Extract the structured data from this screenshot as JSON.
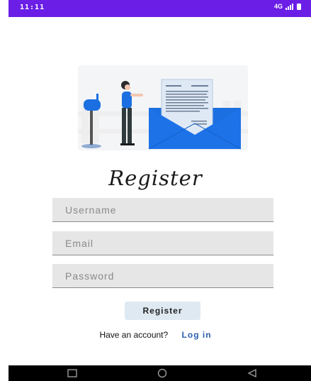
{
  "status_bar": {
    "time": "11:11",
    "network": "4G",
    "color": "#6a1ee6"
  },
  "header": {
    "title": "Register"
  },
  "form": {
    "username_placeholder": "Username",
    "email_placeholder": "Email",
    "password_placeholder": "Password",
    "register_label": "Register"
  },
  "footer": {
    "prompt": "Have an account?",
    "login_label": "Log in"
  },
  "nav_bar": {
    "buttons": [
      "recents-square-icon",
      "home-circle-icon",
      "back-triangle-icon"
    ]
  },
  "colors": {
    "accent": "#2a5fb0",
    "envelope": "#1b6fe0",
    "status": "#6a1ee6"
  }
}
